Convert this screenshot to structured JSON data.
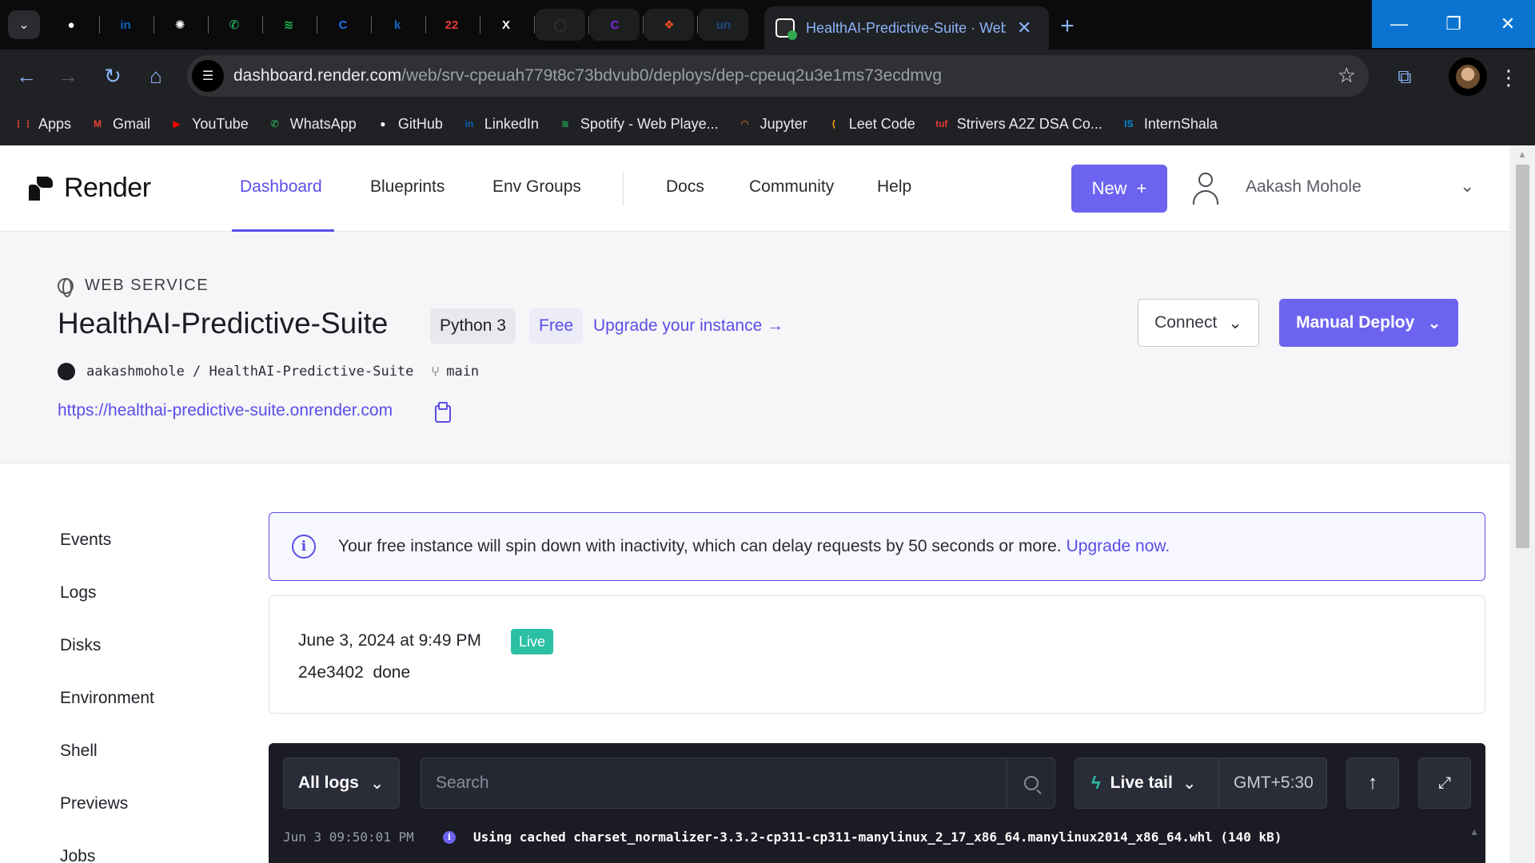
{
  "browser": {
    "active_tab_title": "HealthAI-Predictive-Suite · Web Service",
    "pinned_tabs": [
      {
        "name": "github-tab",
        "icon": "github-icon",
        "glyph": "●",
        "color": "#ffffff"
      },
      {
        "name": "linkedin-tab",
        "icon": "linkedin-icon",
        "glyph": "in",
        "color": "#0a66c2"
      },
      {
        "name": "chatgpt-tab",
        "icon": "chatgpt-icon",
        "glyph": "✺",
        "color": "#ffffff"
      },
      {
        "name": "whatsapp-tab",
        "icon": "whatsapp-icon",
        "glyph": "✆",
        "color": "#25d366"
      },
      {
        "name": "spotify-tab",
        "icon": "spotify-icon",
        "glyph": "≋",
        "color": "#1db954"
      },
      {
        "name": "c-tab",
        "icon": "c-icon",
        "glyph": "C",
        "color": "#1a73e8"
      },
      {
        "name": "k-tab",
        "icon": "k-icon",
        "glyph": "k",
        "color": "#1565c0"
      },
      {
        "name": "calendar-tab",
        "icon": "calendar-icon",
        "glyph": "22",
        "color": "#e53935"
      },
      {
        "name": "x-tab",
        "icon": "x-icon",
        "glyph": "X",
        "color": "#ffffff"
      },
      {
        "name": "circle-tab",
        "icon": "circle-icon",
        "glyph": "◯",
        "color": "#3c4043"
      },
      {
        "name": "canva-tab",
        "icon": "canva-icon",
        "glyph": "C",
        "color": "#7d2ae8"
      },
      {
        "name": "figma-tab",
        "icon": "figma-icon",
        "glyph": "❖",
        "color": "#f24e1e"
      },
      {
        "name": "unstop-tab",
        "icon": "unstop-icon",
        "glyph": "un",
        "color": "#1c4980"
      }
    ],
    "url_host": "dashboard.render.com",
    "url_path": "/web/srv-cpeuah779t8c73bdvub0/deploys/dep-cpeuq2u3e1ms73ecdmvg",
    "bookmarks": [
      {
        "label": "Apps",
        "icon": "apps-icon",
        "color": "#ea4335",
        "glyph": "⋮⋮"
      },
      {
        "label": "Gmail",
        "icon": "gmail-icon",
        "color": "#ea4335",
        "glyph": "M"
      },
      {
        "label": "YouTube",
        "icon": "youtube-icon",
        "color": "#ff0000",
        "glyph": "▶"
      },
      {
        "label": "WhatsApp",
        "icon": "whatsapp-icon",
        "color": "#25d366",
        "glyph": "✆"
      },
      {
        "label": "GitHub",
        "icon": "github-icon",
        "color": "#ffffff",
        "glyph": "●"
      },
      {
        "label": "LinkedIn",
        "icon": "linkedin-icon",
        "color": "#0a66c2",
        "glyph": "in"
      },
      {
        "label": "Spotify - Web Playe...",
        "icon": "spotify-icon",
        "color": "#1db954",
        "glyph": "≋"
      },
      {
        "label": "Jupyter",
        "icon": "jupyter-icon",
        "color": "#f37626",
        "glyph": "◠"
      },
      {
        "label": "Leet Code",
        "icon": "leetcode-icon",
        "color": "#ffa116",
        "glyph": "⟨"
      },
      {
        "label": "Strivers A2Z DSA Co...",
        "icon": "tuf-icon",
        "color": "#e53935",
        "glyph": "tuf"
      },
      {
        "label": "InternShala",
        "icon": "internshala-icon",
        "color": "#008bdc",
        "glyph": "IS"
      }
    ]
  },
  "app": {
    "brand": "Render",
    "nav": [
      "Dashboard",
      "Blueprints",
      "Env Groups",
      "Docs",
      "Community",
      "Help"
    ],
    "new_button": "New",
    "user_name": "Aakash Mohole"
  },
  "service": {
    "kind": "WEB SERVICE",
    "name": "HealthAI-Predictive-Suite",
    "runtime": "Python 3",
    "plan": "Free",
    "upgrade_link": "Upgrade your instance →",
    "repo": "aakashmohole / HealthAI-Predictive-Suite",
    "branch": "main",
    "url": "https://healthai-predictive-suite.onrender.com",
    "connect_button": "Connect",
    "deploy_button": "Manual Deploy"
  },
  "sidebar": [
    "Events",
    "Logs",
    "Disks",
    "Environment",
    "Shell",
    "Previews",
    "Jobs"
  ],
  "banner": {
    "text": "Your free instance will spin down with inactivity, which can delay requests by 50 seconds or more.",
    "link": "Upgrade now."
  },
  "deploy": {
    "date": "June 3, 2024 at 9:49 PM",
    "status": "Live",
    "commit": "24e3402",
    "result": "done"
  },
  "logs": {
    "filter": "All logs",
    "search_placeholder": "Search",
    "live_tail": "Live tail",
    "timezone": "GMT+5:30",
    "lines": [
      {
        "time": "Jun 3 09:50:01 PM",
        "message": "Using cached charset_normalizer-3.3.2-cp311-cp311-manylinux_2_17_x86_64.manylinux2014_x86_64.whl (140 kB)"
      }
    ]
  },
  "colors": {
    "accent": "#5b4de8",
    "button": "#6c63f0",
    "live": "#2bbfa4",
    "log_bg": "#1a1b24"
  }
}
